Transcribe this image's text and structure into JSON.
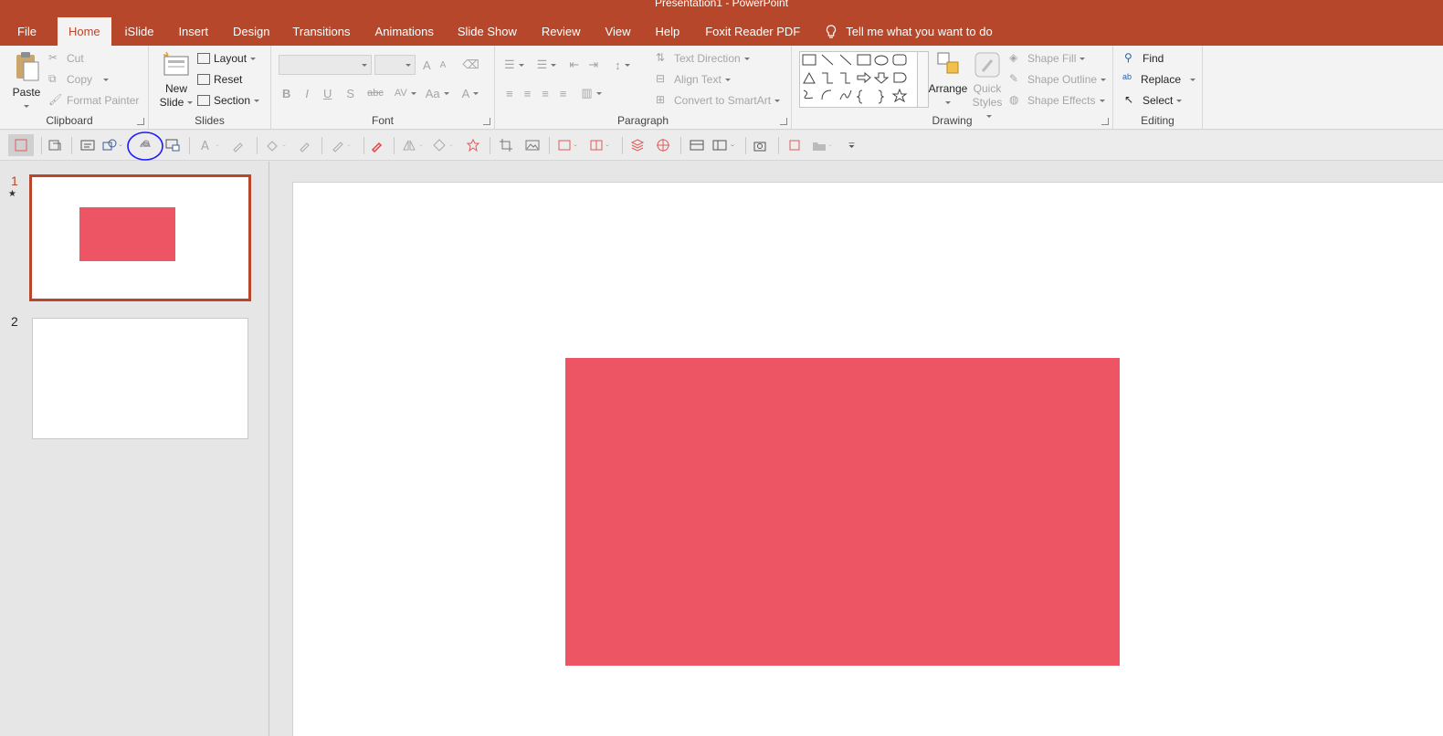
{
  "app": {
    "title": "Presentation1  -  PowerPoint"
  },
  "tabs": [
    {
      "label": "File"
    },
    {
      "label": "Home"
    },
    {
      "label": "iSlide"
    },
    {
      "label": "Insert"
    },
    {
      "label": "Design"
    },
    {
      "label": "Transitions"
    },
    {
      "label": "Animations"
    },
    {
      "label": "Slide Show"
    },
    {
      "label": "Review"
    },
    {
      "label": "View"
    },
    {
      "label": "Help"
    },
    {
      "label": "Foxit Reader PDF"
    }
  ],
  "tellme": "Tell me what you want to do",
  "ribbon": {
    "clipboard": {
      "label": "Clipboard",
      "paste": "Paste",
      "cut": "Cut",
      "copy": "Copy",
      "format_painter": "Format Painter"
    },
    "slides": {
      "label": "Slides",
      "new_slide_1": "New",
      "new_slide_2": "Slide",
      "layout": "Layout",
      "reset": "Reset",
      "section": "Section"
    },
    "font": {
      "label": "Font",
      "bold": "B",
      "italic": "I",
      "underline": "U",
      "shadow": "S",
      "strike": "abc",
      "spacing": "AV",
      "case": "Aa",
      "color": "A",
      "grow": "A",
      "shrink": "A"
    },
    "paragraph": {
      "label": "Paragraph",
      "text_direction": "Text Direction",
      "align_text": "Align Text",
      "convert_smartart": "Convert to SmartArt"
    },
    "drawing": {
      "label": "Drawing",
      "arrange": "Arrange",
      "quick_styles_1": "Quick",
      "quick_styles_2": "Styles",
      "shape_fill": "Shape Fill",
      "shape_outline": "Shape Outline",
      "shape_effects": "Shape Effects"
    },
    "editing": {
      "label": "Editing",
      "find": "Find",
      "replace": "Replace",
      "select": "Select"
    }
  },
  "slides_pane": [
    {
      "number": "1",
      "star": "★"
    },
    {
      "number": "2"
    }
  ],
  "colors": {
    "accent": "#b7472a",
    "shape_fill": "#ed5565",
    "annotation": "#1a1aff"
  }
}
